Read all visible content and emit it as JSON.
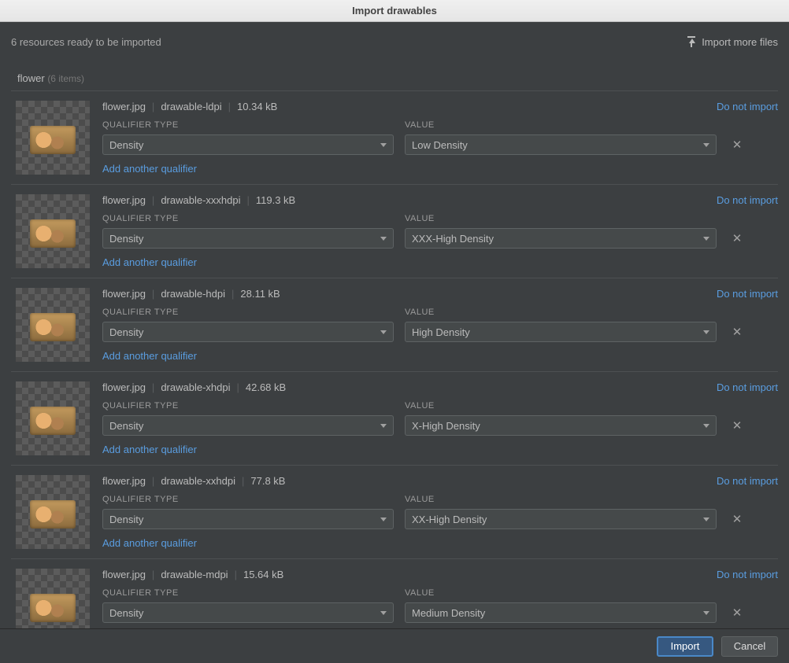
{
  "window": {
    "title": "Import drawables"
  },
  "toolbar": {
    "status": "6 resources ready to be imported",
    "import_more": "Import more files"
  },
  "group": {
    "name": "flower",
    "count": "(6 items)"
  },
  "labels": {
    "qualifier_type": "QUALIFIER TYPE",
    "value": "VALUE",
    "do_not_import": "Do not import",
    "add_qualifier": "Add another qualifier"
  },
  "items": [
    {
      "file": "flower.jpg",
      "folder": "drawable-ldpi",
      "size": "10.34 kB",
      "qualifier": "Density",
      "value": "Low Density"
    },
    {
      "file": "flower.jpg",
      "folder": "drawable-xxxhdpi",
      "size": "119.3 kB",
      "qualifier": "Density",
      "value": "XXX-High Density"
    },
    {
      "file": "flower.jpg",
      "folder": "drawable-hdpi",
      "size": "28.11 kB",
      "qualifier": "Density",
      "value": "High Density"
    },
    {
      "file": "flower.jpg",
      "folder": "drawable-xhdpi",
      "size": "42.68 kB",
      "qualifier": "Density",
      "value": "X-High Density"
    },
    {
      "file": "flower.jpg",
      "folder": "drawable-xxhdpi",
      "size": "77.8 kB",
      "qualifier": "Density",
      "value": "XX-High Density"
    },
    {
      "file": "flower.jpg",
      "folder": "drawable-mdpi",
      "size": "15.64 kB",
      "qualifier": "Density",
      "value": "Medium Density"
    }
  ],
  "buttons": {
    "import": "Import",
    "cancel": "Cancel"
  }
}
